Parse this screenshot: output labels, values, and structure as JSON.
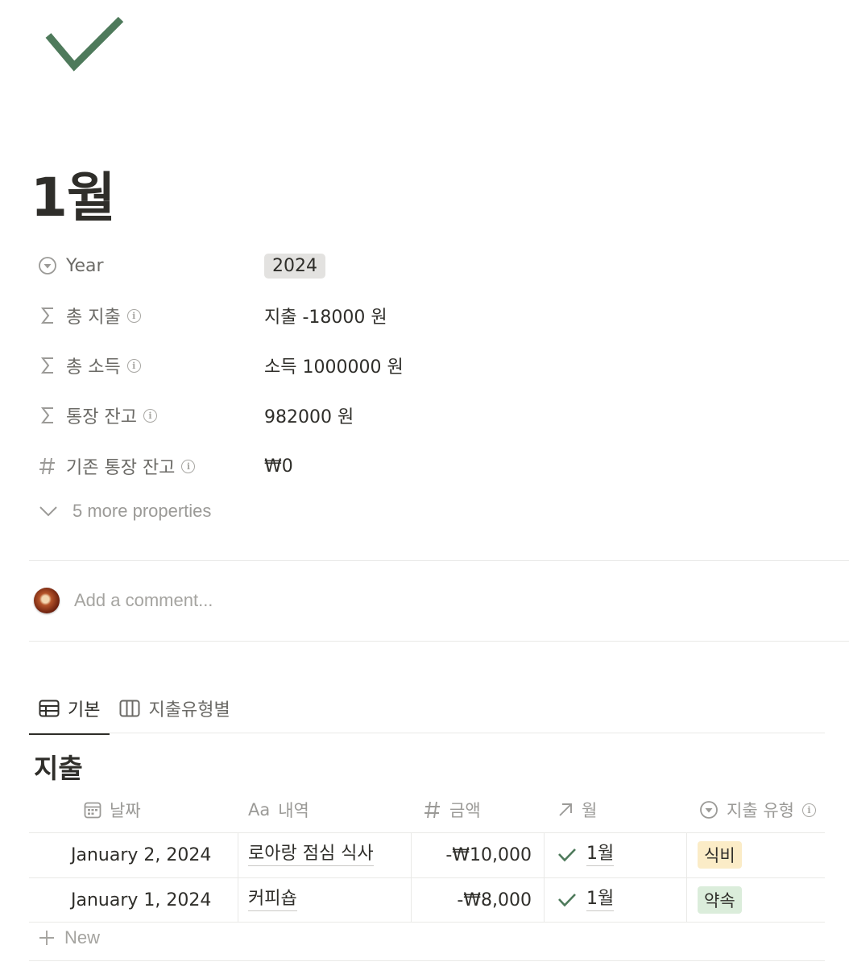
{
  "page": {
    "icon": "checkmark-icon",
    "title": "1월"
  },
  "properties": [
    {
      "icon": "select-icon",
      "name": "Year",
      "value": "2024",
      "info": false
    },
    {
      "icon": "sigma-icon",
      "name": "총 지출",
      "value": "지출 -18000 원",
      "info": true
    },
    {
      "icon": "sigma-icon",
      "name": "총 소득",
      "value": "소득 1000000 원",
      "info": true
    },
    {
      "icon": "sigma-icon",
      "name": "통장 잔고",
      "value": "982000 원",
      "info": true
    },
    {
      "icon": "hash-icon",
      "name": "기존 통장 잔고",
      "value": "₩0",
      "info": true
    }
  ],
  "more_properties": "5 more properties",
  "comment": {
    "placeholder": "Add a comment..."
  },
  "views": [
    {
      "label": "기본",
      "icon": "table-icon",
      "active": true
    },
    {
      "label": "지출유형별",
      "icon": "board-icon",
      "active": false
    }
  ],
  "database": {
    "title": "지출",
    "columns": [
      {
        "icon": "calendar-icon",
        "label": "날짜"
      },
      {
        "icon": "title-icon",
        "label": "내역"
      },
      {
        "icon": "hash-icon",
        "label": "금액"
      },
      {
        "icon": "relation-arrow-icon",
        "label": "월"
      },
      {
        "icon": "select-icon",
        "label": "지출 유형"
      }
    ],
    "rows": [
      {
        "date": "January 2, 2024",
        "name": "로아랑 점심 식사",
        "amount": "-₩10,000",
        "month": "1월",
        "type": "식비",
        "type_color": "#fbecc7"
      },
      {
        "date": "January 1, 2024",
        "name": "커피숍",
        "amount": "-₩8,000",
        "month": "1월",
        "type": "약속",
        "type_color": "#dbeddb"
      }
    ],
    "new_label": "New"
  },
  "colors": {
    "accent_green": "#4a7c59",
    "text": "#37352f",
    "muted": "#9b9a97"
  }
}
